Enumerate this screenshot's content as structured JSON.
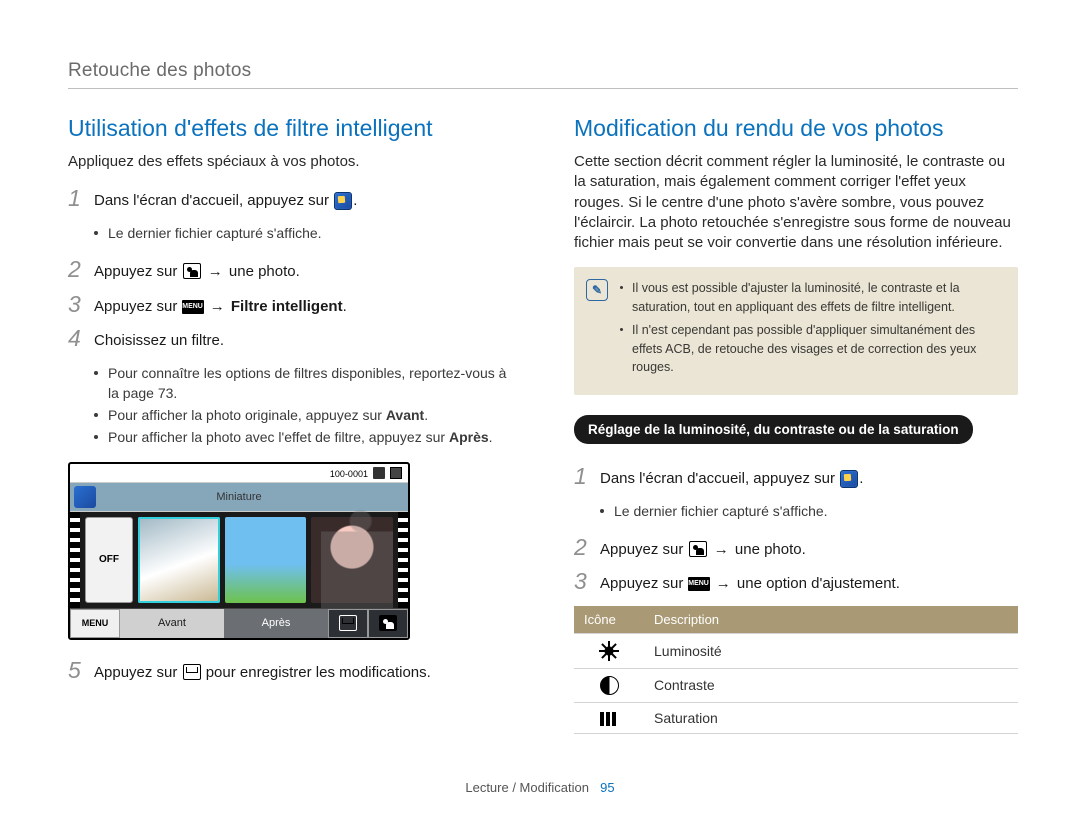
{
  "header": "Retouche des photos",
  "left": {
    "title": "Utilisation d'effets de ﬁltre intelligent",
    "intro": "Appliquez des effets spéciaux à vos photos.",
    "step1": "Dans l'écran d'accueil, appuyez sur ",
    "step1_note": "Le dernier ﬁchier capturé s'afﬁche.",
    "step2_a": "Appuyez sur ",
    "step2_b": " une photo.",
    "step3_a": "Appuyez sur ",
    "step3_b": "Filtre intelligent",
    "step4": "Choisissez un ﬁltre.",
    "step4_b1": "Pour connaître les options de ﬁltres disponibles, reportez-vous à la page 73.",
    "step4_b2_a": "Pour afﬁcher la photo originale, appuyez sur ",
    "step4_b2_b": "Avant",
    "step4_b3_a": "Pour afﬁcher la photo avec l'effet de ﬁltre, appuyez sur ",
    "step4_b3_b": "Après",
    "step5_a": "Appuyez sur ",
    "step5_b": " pour enregistrer les modiﬁcations.",
    "preview": {
      "counter": "100-0001",
      "miniature": "Miniature",
      "off": "OFF",
      "menu": "MENU",
      "avant": "Avant",
      "apres": "Après"
    }
  },
  "right": {
    "title": "Modiﬁcation du rendu de vos photos",
    "intro": "Cette section décrit comment régler la luminosité, le contraste ou la saturation, mais également comment corriger l'effet yeux rouges. Si le centre d'une photo s'avère sombre, vous pouvez l'éclaircir. La photo retouchée s'enregistre sous forme de nouveau ﬁchier mais peut se voir convertie dans une résolution inférieure.",
    "note1": "Il vous est possible d'ajuster la luminosité, le contraste et la saturation, tout en appliquant des effets de ﬁltre intelligent.",
    "note2": "Il n'est cependant pas possible d'appliquer simultanément des effets ACB, de retouche des visages et de correction des yeux rouges.",
    "pill": "Réglage de la luminosité, du contraste ou de la saturation",
    "step1": "Dans l'écran d'accueil, appuyez sur ",
    "step1_note": "Le dernier ﬁchier capturé s'afﬁche.",
    "step2_a": "Appuyez sur ",
    "step2_b": " une photo.",
    "step3_a": "Appuyez sur ",
    "step3_b": " une option d'ajustement.",
    "table": {
      "h1": "Icône",
      "h2": "Description",
      "r1": "Luminosité",
      "r2": "Contraste",
      "r3": "Saturation"
    }
  },
  "footer": {
    "section": "Lecture / Modiﬁcation",
    "page": "95"
  },
  "arrow": "→",
  "menu_text": "MENU"
}
